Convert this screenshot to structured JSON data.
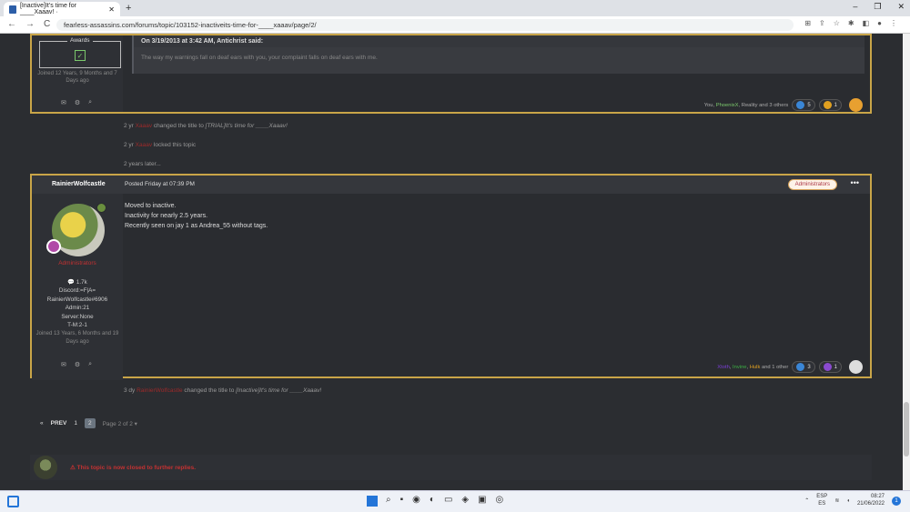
{
  "browser": {
    "tab_title": "[Inactive]It's time for ____Xaaav! ·",
    "tab_close": "✕",
    "new_tab": "+",
    "window_controls": [
      "–",
      "❐",
      "✕"
    ],
    "url": "fearless-assassins.com/forums/topic/103152-inactiveits-time-for-____xaaav/page/2/",
    "nav": [
      "←",
      "→",
      "C"
    ],
    "extensions": [
      "⊞",
      "⇪",
      "☆",
      "✱",
      "◧",
      "●",
      "⋮"
    ]
  },
  "post1": {
    "awards_label": "Awards",
    "award_icon": "✓",
    "joined": "Joined 12 Years, 9 Months and 7 Days ago",
    "quote_header": "On 3/19/2013 at 3:42 AM, Antichrist said:",
    "quote_text": "The way my warnings fall on deaf ears with you,  your complaint falls on deaf ears with me.",
    "reactions_text": "You, ",
    "reaction_user": "PhoenixX",
    "reactions_rest": ", Reality and 3 others",
    "count1": "5",
    "count2": "1"
  },
  "events": [
    {
      "time": "2 yr",
      "user": "Xaaav",
      "action": " changed the title to ",
      "title": "[TRIAL]It's time for ____Xaaav!"
    },
    {
      "time": "2 yr",
      "user": "Xaaav",
      "action": " locked this topic"
    }
  ],
  "later": "2 years later...",
  "post2": {
    "author": "RainierWolfcastle",
    "date": "Posted Friday at 07:39 PM",
    "badge": "Administrators",
    "more": "•••",
    "lines": [
      "Moved to inactive.",
      "Inactivity for nearly 2.5 years.",
      "Recently seen on jay 1 as Andrea_55 without tags."
    ],
    "role": "Administrators",
    "posts": "💬 1.7k",
    "discord": "Discord:=F|A=",
    "discord_tag": "RainierWolfcastle#6906",
    "admin": "Admin:21",
    "server": "Server:None",
    "tm": "T-M:2-1",
    "joined": "Joined 13 Years, 6 Months and 19 Days ago",
    "reactors": [
      {
        "name": "Xtoth",
        "color": "#7b3fd6"
      },
      {
        "name": "Invine",
        "color": "#3cb043"
      },
      {
        "name": "Hulk",
        "color": "#e0a020"
      }
    ],
    "reactions_rest": " and 1 other",
    "count1": "3",
    "count2": "1"
  },
  "event3": {
    "time": "3 dy",
    "user": "RainierWolfcastle",
    "action": " changed the title to ",
    "title": "[Inactive]It's time for ____Xaaav!"
  },
  "pager": {
    "prev": "PREV",
    "p1": "1",
    "p2": "2",
    "label": "Page 2 of 2 ▾",
    "first": "«"
  },
  "closed_notice": "⚠ This topic is now closed to further replies.",
  "tray": {
    "lang": "ESP",
    "region": "ES",
    "time": "08:27",
    "date": "21/06/2022",
    "notif": "1"
  },
  "colors": {
    "gold_border": "#c9a548",
    "admin_red": "#c53232",
    "bg": "#2b2d31"
  }
}
